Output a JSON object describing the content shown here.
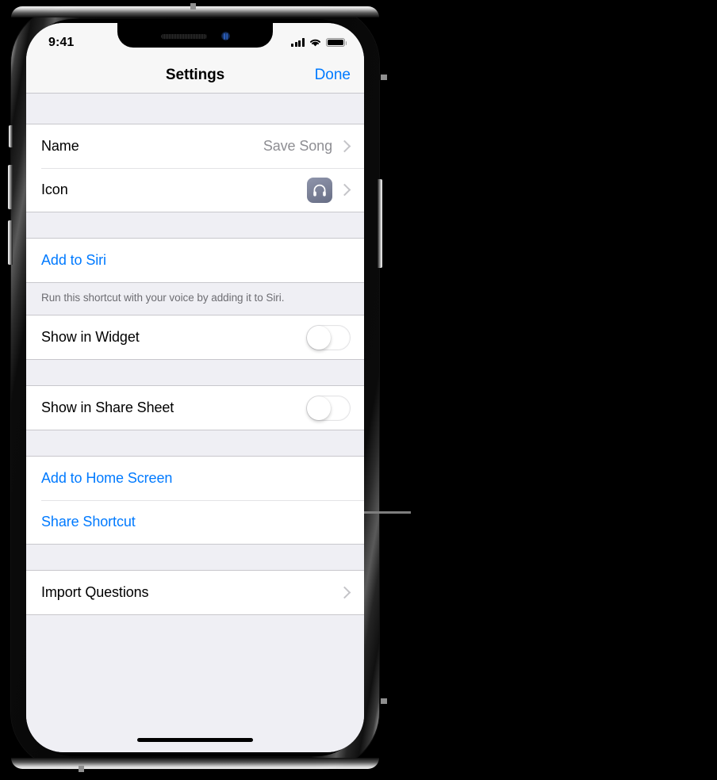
{
  "device": {
    "status_bar": {
      "time": "9:41",
      "cellular_icon": "signal-bars-icon",
      "wifi_icon": "wifi-icon",
      "battery_icon": "battery-full-icon"
    },
    "notch": {
      "speaker_icon": "speaker-grille-icon",
      "camera_icon": "front-camera-icon"
    },
    "home_indicator": "home-indicator"
  },
  "nav": {
    "title": "Settings",
    "done_label": "Done"
  },
  "sections": [
    {
      "id": "details",
      "rows": [
        {
          "label": "Name",
          "value": "Save Song",
          "type": "disclosure",
          "accessory": "chevron-right-icon"
        },
        {
          "label": "Icon",
          "value": "",
          "type": "icon-disclosure",
          "icon": "headphones-icon",
          "accessory": "chevron-right-icon"
        }
      ]
    },
    {
      "id": "siri",
      "rows": [
        {
          "label": "Add to Siri",
          "type": "link"
        }
      ],
      "footer": "Run this shortcut with your voice by adding it to Siri."
    },
    {
      "id": "widget",
      "rows": [
        {
          "label": "Show in Widget",
          "type": "toggle",
          "value": "off"
        }
      ]
    },
    {
      "id": "share-sheet",
      "rows": [
        {
          "label": "Show in Share Sheet",
          "type": "toggle",
          "value": "off"
        }
      ]
    },
    {
      "id": "actions",
      "rows": [
        {
          "label": "Add to Home Screen",
          "type": "link"
        },
        {
          "label": "Share Shortcut",
          "type": "link"
        }
      ]
    },
    {
      "id": "import",
      "rows": [
        {
          "label": "Import Questions",
          "type": "disclosure",
          "accessory": "chevron-right-icon"
        }
      ]
    }
  ],
  "colors": {
    "accent_blue": "#007aff",
    "group_background": "#ffffff",
    "page_background": "#efeff4",
    "secondary_text": "#8e8e93",
    "footnote_text": "#6d6d72",
    "separator": "#c8c7cc",
    "icon_tile": "#7d8399"
  },
  "annotation": {
    "callout_line": "callout-leader-line"
  }
}
